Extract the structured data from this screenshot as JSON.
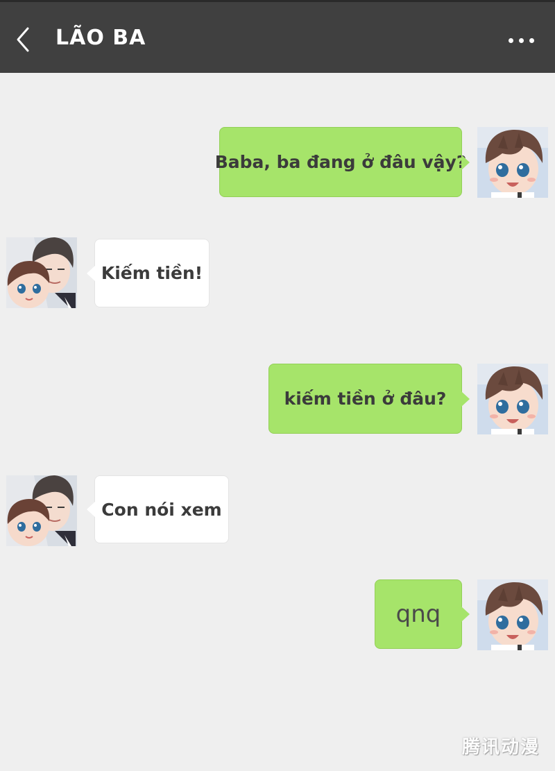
{
  "header": {
    "title": "LÃO BA",
    "back_icon": "chevron-left-icon",
    "more_icon": "more-dots-icon"
  },
  "colors": {
    "header_bg": "#404040",
    "chat_bg": "#efefef",
    "my_bubble": "#a6e46a",
    "their_bubble": "#ffffff"
  },
  "messages": [
    {
      "sender": "me",
      "text": "Baba, ba đang ở đâu vậy?"
    },
    {
      "sender": "them",
      "text": "Kiếm tiền!"
    },
    {
      "sender": "me",
      "text": "kiếm tiền ở đâu?"
    },
    {
      "sender": "them",
      "text": "Con nói xem"
    },
    {
      "sender": "me",
      "text": "qnq"
    }
  ],
  "watermark": "腾讯动漫"
}
